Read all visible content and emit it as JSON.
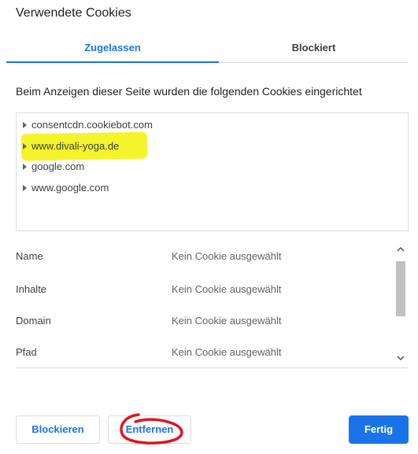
{
  "dialog": {
    "title": "Verwendete Cookies"
  },
  "tabs": [
    {
      "label": "Zugelassen",
      "active": true
    },
    {
      "label": "Blockiert",
      "active": false
    }
  ],
  "info_text": "Beim Anzeigen dieser Seite wurden die folgenden Cookies eingerichtet",
  "tree": {
    "items": [
      {
        "label": "consentcdn.cookiebot.com"
      },
      {
        "label": "www.divali-yoga.de",
        "highlighted": true
      },
      {
        "label": "google.com"
      },
      {
        "label": "www.google.com"
      }
    ]
  },
  "details": {
    "rows": [
      {
        "label": "Name",
        "value": "Kein Cookie ausgewählt"
      },
      {
        "label": "Inhalte",
        "value": "Kein Cookie ausgewählt"
      },
      {
        "label": "Domain",
        "value": "Kein Cookie ausgewählt"
      },
      {
        "label": "Pfad",
        "value": "Kein Cookie ausgewählt"
      }
    ]
  },
  "buttons": {
    "block_label": "Blockieren",
    "remove_label": "Entfernen",
    "done_label": "Fertig"
  },
  "colors": {
    "accent": "#1a73e8",
    "highlight": "#f4f21a",
    "annotation": "#e0141e"
  },
  "icons": {
    "tree_expand": "triangle-right-icon",
    "scroll_up": "chevron-up-icon",
    "scroll_down": "chevron-down-icon"
  }
}
